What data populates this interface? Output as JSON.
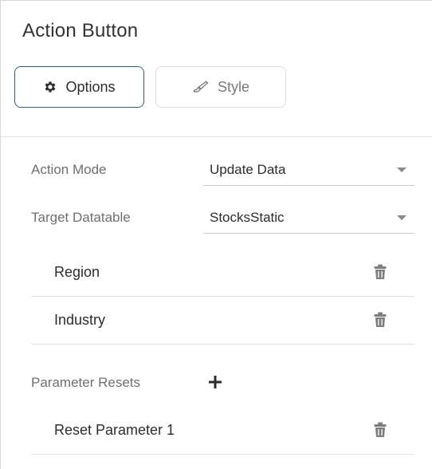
{
  "panel": {
    "title": "Action Button"
  },
  "tabs": [
    {
      "label": "Options",
      "icon": "gear-icon",
      "active": true
    },
    {
      "label": "Style",
      "icon": "brush-icon",
      "active": false
    }
  ],
  "form": {
    "action_mode_label": "Action Mode",
    "action_mode_value": "Update Data",
    "target_datatable_label": "Target Datatable",
    "target_datatable_value": "StocksStatic"
  },
  "columns": [
    {
      "label": "Region",
      "icon": "trash-icon"
    },
    {
      "label": "Industry",
      "icon": "trash-icon"
    }
  ],
  "parameter_resets": {
    "label": "Parameter Resets",
    "add_icon": "plus-icon",
    "items": [
      {
        "label": "Reset Parameter 1",
        "icon": "trash-icon"
      }
    ]
  },
  "colors": {
    "active_tab_border": "#2f5f71",
    "label_text": "#6f6f6f",
    "icon_gray": "#7d7d7d"
  }
}
